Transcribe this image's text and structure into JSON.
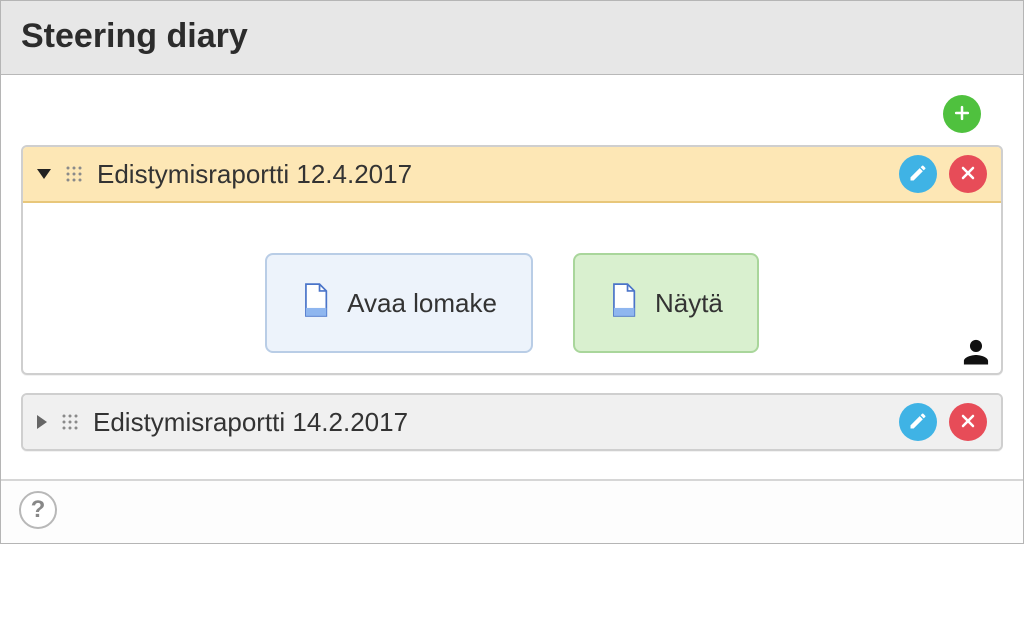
{
  "header": {
    "title": "Steering diary"
  },
  "toolbar": {
    "add_tooltip": "Add"
  },
  "entries": [
    {
      "title": "Edistymisraportti 12.4.2017",
      "expanded": true,
      "buttons": {
        "open_form": "Avaa lomake",
        "show": "Näytä"
      }
    },
    {
      "title": "Edistymisraportti 14.2.2017",
      "expanded": false
    }
  ],
  "footer": {
    "help": "?"
  }
}
